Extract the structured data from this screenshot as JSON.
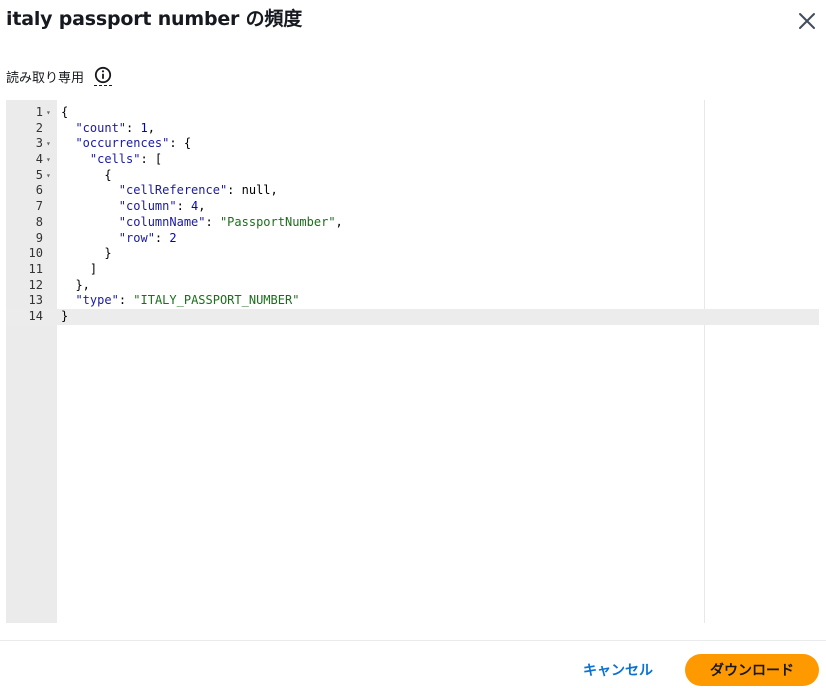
{
  "modal": {
    "title": "italy passport number の頻度",
    "subtitle": "読み取り専用",
    "close_icon": "close-icon",
    "info_icon": "info-icon"
  },
  "editor": {
    "lines": [
      {
        "n": "1",
        "fold": true,
        "code": "{"
      },
      {
        "n": "2",
        "fold": false,
        "code": "  \"count\": 1,"
      },
      {
        "n": "3",
        "fold": true,
        "code": "  \"occurrences\": {"
      },
      {
        "n": "4",
        "fold": true,
        "code": "    \"cells\": ["
      },
      {
        "n": "5",
        "fold": true,
        "code": "      {"
      },
      {
        "n": "6",
        "fold": false,
        "code": "        \"cellReference\": null,"
      },
      {
        "n": "7",
        "fold": false,
        "code": "        \"column\": 4,"
      },
      {
        "n": "8",
        "fold": false,
        "code": "        \"columnName\": \"PassportNumber\","
      },
      {
        "n": "9",
        "fold": false,
        "code": "        \"row\": 2"
      },
      {
        "n": "10",
        "fold": false,
        "code": "      }"
      },
      {
        "n": "11",
        "fold": false,
        "code": "    ]"
      },
      {
        "n": "12",
        "fold": false,
        "code": "  },"
      },
      {
        "n": "13",
        "fold": false,
        "code": "  \"type\": \"ITALY_PASSPORT_NUMBER\""
      },
      {
        "n": "14",
        "fold": false,
        "code": "}",
        "active": true
      }
    ]
  },
  "footer": {
    "cancel_label": "キャンセル",
    "download_label": "ダウンロード"
  },
  "colors": {
    "primary_button": "#ff9900",
    "link": "#0972d3",
    "json_key": "#1a1aa6",
    "json_string": "#1a6f1a",
    "json_number": "#0000cd"
  }
}
